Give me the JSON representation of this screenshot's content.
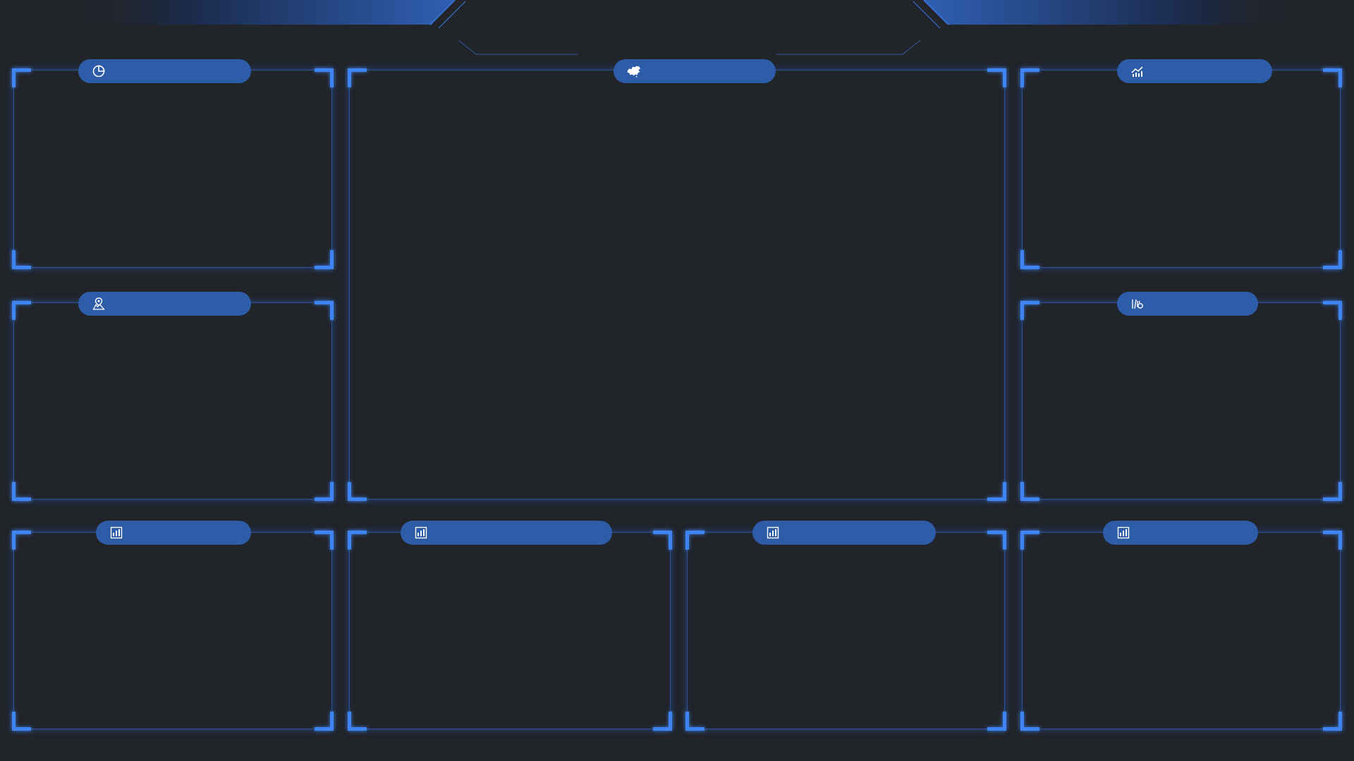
{
  "theme": {
    "background": "#212429",
    "frame_color": "#3f84f3",
    "pill_color": "#2d5ca8",
    "header_accent": "#2f5fb3"
  },
  "header": {
    "title": ""
  },
  "panels": {
    "top_left": {
      "icon": "pie-chart-icon",
      "title": ""
    },
    "middle_left": {
      "icon": "map-pin-icon",
      "title": ""
    },
    "center_map": {
      "icon": "china-map-icon",
      "title": ""
    },
    "top_right": {
      "icon": "line-trend-icon",
      "title": ""
    },
    "middle_right": {
      "icon": "chart-cursor-icon",
      "title": ""
    },
    "bottom_1": {
      "icon": "bar-chart-icon",
      "title": ""
    },
    "bottom_2": {
      "icon": "bar-chart-icon",
      "title": ""
    },
    "bottom_3": {
      "icon": "bar-chart-icon",
      "title": ""
    },
    "bottom_4": {
      "icon": "bar-chart-icon",
      "title": ""
    }
  }
}
